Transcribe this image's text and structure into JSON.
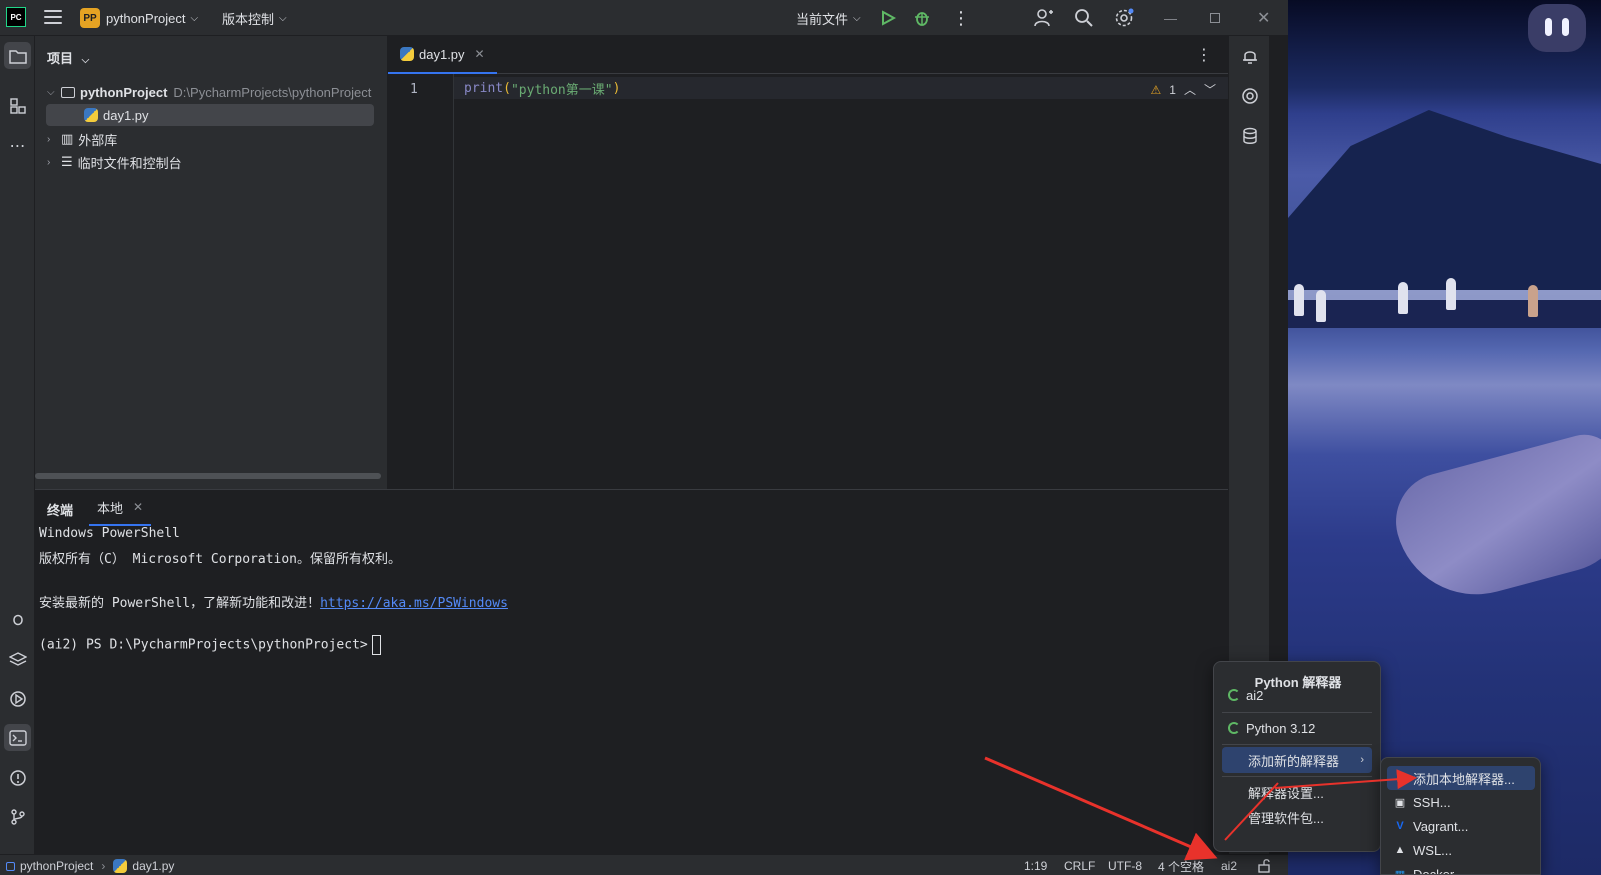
{
  "titlebar": {
    "app_logo": "PC",
    "project_badge": "PP",
    "project_name": "pythonProject",
    "vcs_menu": "版本控制",
    "run_config": "当前文件"
  },
  "project_panel": {
    "title": "项目",
    "tree": [
      {
        "label": "pythonProject",
        "path": "D:\\PycharmProjects\\pythonProject"
      },
      {
        "label": "day1.py"
      },
      {
        "label": "外部库"
      },
      {
        "label": "临时文件和控制台"
      }
    ]
  },
  "editor": {
    "tab_label": "day1.py",
    "line_number": "1",
    "code_keyword": "print",
    "code_open": "(",
    "code_string": "\"python第一课\"",
    "code_close": ")",
    "warning_count": "1"
  },
  "terminal": {
    "title": "终端",
    "tab_label": "本地",
    "lines": [
      "Windows PowerShell",
      "版权所有（C） Microsoft Corporation。保留所有权利。",
      "安装最新的 PowerShell，了解新功能和改进！",
      "(ai2) PS D:\\PycharmProjects\\pythonProject>"
    ],
    "link": "https://aka.ms/PSWindows"
  },
  "statusbar": {
    "breadcrumb_project": "pythonProject",
    "breadcrumb_file": "day1.py",
    "position": "1:19",
    "line_ending": "CRLF",
    "encoding": "UTF-8",
    "indent": "4 个空格",
    "interpreter": "ai2"
  },
  "interpreter_menu": {
    "title": "Python 解释器",
    "items": [
      "ai2",
      "Python 3.12",
      "添加新的解释器",
      "解释器设置...",
      "管理软件包..."
    ]
  },
  "add_interpreter_submenu": {
    "items": [
      "添加本地解释器...",
      "SSH...",
      "Vagrant...",
      "WSL...",
      "Docker"
    ]
  },
  "colors": {
    "accent": "#3574f0",
    "annotation_arrow": "#e8322b"
  }
}
